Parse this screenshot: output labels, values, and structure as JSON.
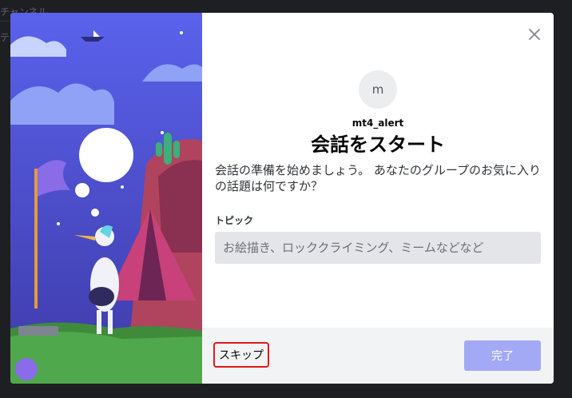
{
  "background": {
    "text_1": "チャンネル",
    "text_2": "テ"
  },
  "modal": {
    "avatar_letter": "m",
    "username": "mt4_alert",
    "title": "会話をスタート",
    "description": "会話の準備を始めましょう。 あなたのグループのお気に入りの話題は何ですか？",
    "topic_label": "トピック",
    "topic_placeholder": "お絵描き、ロッククライミング、ミームなどなど",
    "topic_value": "",
    "skip_label": "スキップ",
    "done_label": "完了",
    "close_icon": "close-icon"
  },
  "colors": {
    "brand": "#5865f2",
    "brand_disabled": "#a3a9f5",
    "highlight": "#e0191b",
    "footer_bg": "#f2f3f5",
    "input_bg": "#e3e5e8"
  }
}
